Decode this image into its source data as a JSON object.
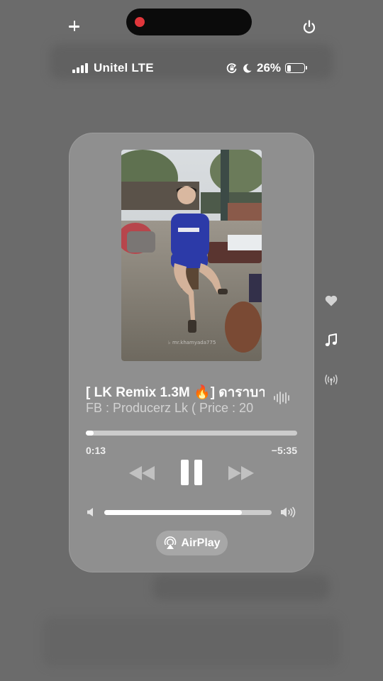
{
  "status_bar": {
    "carrier": "Unitel LTE",
    "battery_percent_text": "26%",
    "battery_level": 0.26,
    "signal_bars": 4
  },
  "player": {
    "title": "[ LK Remix 1.3M 🔥] ดาราบาว",
    "subtitle": "FB : Producerz Lk ( Price : 20",
    "artwork_watermark": "mr.khamyada775",
    "elapsed": "0:13",
    "remaining": "−5:35",
    "progress": 0.037,
    "volume": 0.82,
    "airplay_label": "AirPlay"
  },
  "side_icons": [
    "heart-icon",
    "music-note-icon",
    "broadcast-icon"
  ],
  "colors": {
    "background": "#6b6b6b",
    "panel": "#8f8f8f",
    "record_dot": "#e0363b"
  }
}
